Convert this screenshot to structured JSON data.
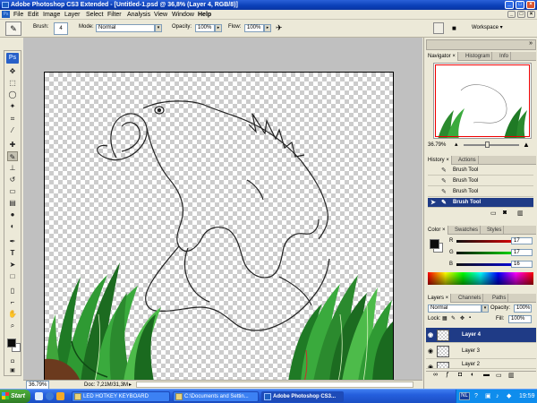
{
  "window": {
    "title": "Adobe Photoshop CS3 Extended - [Untitled-1.psd @ 36,8% (Layer 4, RGB/8)]",
    "min_symbol": "_",
    "max_symbol": "□",
    "close_symbol": "×"
  },
  "menu": {
    "app_icon": "Ps",
    "items": [
      "File",
      "Edit",
      "Image",
      "Layer",
      "Select",
      "Filter",
      "Analysis",
      "View",
      "Window",
      "Help"
    ]
  },
  "options_bar": {
    "brush_label": "Brush:",
    "brush_size": "4",
    "mode_label": "Mode:",
    "mode_value": "Normal",
    "opacity_label": "Opacity:",
    "opacity_value": "100%",
    "flow_label": "Flow:",
    "flow_value": "100%",
    "workspace_label": "Workspace ▾"
  },
  "toolbox": {
    "logo": "Ps",
    "tools": [
      "move",
      "marquee",
      "lasso",
      "magic-wand",
      "crop",
      "slice",
      "healing",
      "brush",
      "stamp",
      "history-brush",
      "eraser",
      "gradient",
      "blur",
      "dodge",
      "pen",
      "type",
      "path-select",
      "shape",
      "notes",
      "eyedropper",
      "hand",
      "zoom"
    ]
  },
  "status_bar": {
    "zoom": "36.79%",
    "doc": "Doc: 7,21M/31,3M"
  },
  "navigator": {
    "tabs": [
      "Navigator ×",
      "Histogram",
      "Info"
    ],
    "zoom": "36.79%"
  },
  "history": {
    "tabs": [
      "History ×",
      "Actions"
    ],
    "items": [
      "Brush Tool",
      "Brush Tool",
      "Brush Tool",
      "Brush Tool"
    ],
    "selected_index": 3
  },
  "color_panel": {
    "tabs": [
      "Color ×",
      "Swatches",
      "Styles"
    ],
    "channels": [
      {
        "label": "R",
        "value": "17"
      },
      {
        "label": "G",
        "value": "17"
      },
      {
        "label": "B",
        "value": "16"
      }
    ]
  },
  "layers": {
    "tabs": [
      "Layers ×",
      "Channels",
      "Paths"
    ],
    "blend_mode": "Normal",
    "opacity_label": "Opacity:",
    "opacity_value": "100%",
    "lock_label": "Lock:",
    "fill_label": "Fill:",
    "fill_value": "100%",
    "items": [
      "Layer 4",
      "Layer 3",
      "Layer 2"
    ],
    "selected_index": 0
  },
  "taskbar": {
    "start_label": "Start",
    "tasks": [
      "LED HOTKEY KEYBOARD",
      "C:\\Documents and Settin...",
      "Adobe Photoshop CS3..."
    ],
    "active_task": 2,
    "tray_lang": "NL",
    "clock": "19:59"
  },
  "colors": {
    "title_blue": "#0a3fb8",
    "selected_row": "#1f3b86",
    "grass_green": "#2b8a2e",
    "taskbar_blue": "#245edc",
    "start_green": "#3d9530"
  }
}
